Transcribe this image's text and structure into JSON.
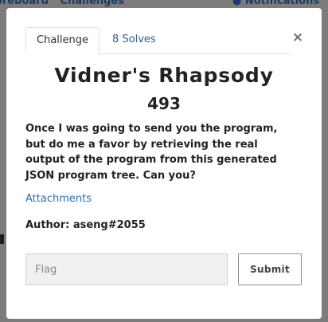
{
  "background": {
    "nav_left": [
      "oreboard",
      "Challenges"
    ],
    "nav_right": "Notifications"
  },
  "modal": {
    "close_symbol": "×",
    "tabs": [
      {
        "label": "Challenge",
        "active": true
      },
      {
        "label": "8 Solves",
        "active": false
      }
    ],
    "title": "Vidner's Rhapsody",
    "points": "493",
    "description": "Once I was going to send you the program, but do me a favor by retrieving the real output of the program from this generated JSON program tree. Can you?",
    "attachments_label": "Attachments",
    "author": "Author: aseng#2055",
    "flag_placeholder": "Flag",
    "submit_label": "Submit"
  },
  "colors": {
    "overlay": "#7c7c7c",
    "link": "#2f6fa8",
    "text": "#222222"
  },
  "icons": {
    "notification": "bell-icon",
    "close": "close-icon"
  }
}
